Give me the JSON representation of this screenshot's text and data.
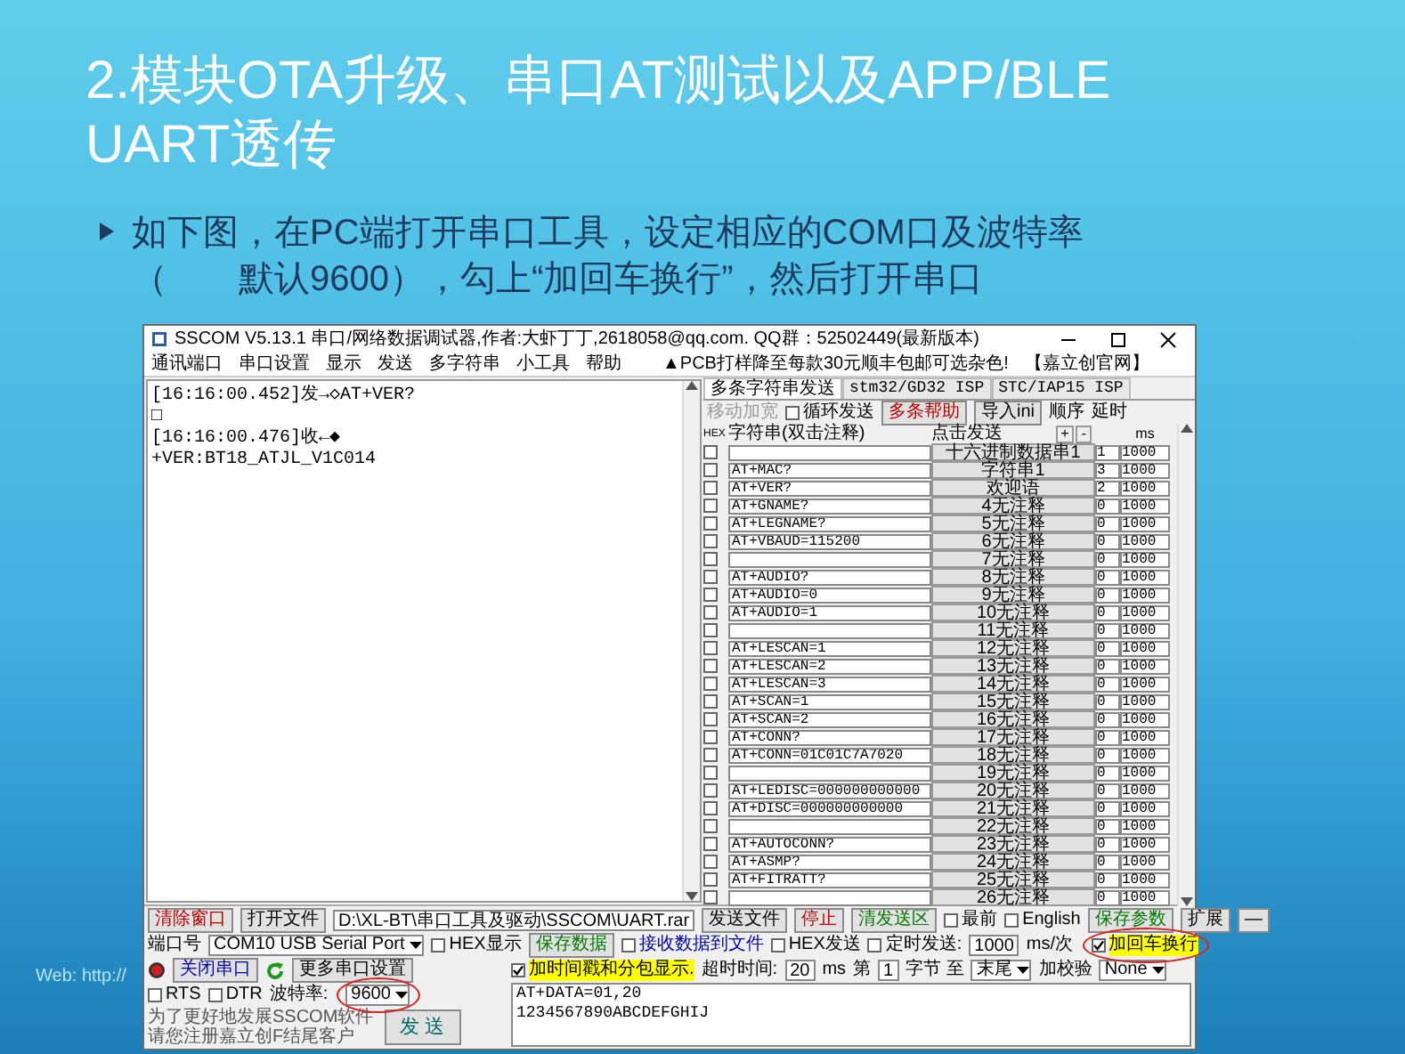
{
  "slide": {
    "title": "2.模块OTA升级、串口AT测试以及APP/BLE UART透传",
    "bullet": "如下图，在PC端打开串口工具，设定相应的COM口及波特率（　　默认9600），勾上“加回车换行”，然后打开串口",
    "footer": "Web: http://"
  },
  "window": {
    "title": "SSCOM V5.13.1 串口/网络数据调试器,作者:大虾丁丁,2618058@qq.com. QQ群：52502449(最新版本)"
  },
  "menu": [
    "通讯端口",
    "串口设置",
    "显示",
    "发送",
    "多字符串",
    "小工具",
    "帮助"
  ],
  "menu_ad": "▲PCB打样降至每款30元顺丰包邮可选杂色!",
  "menu_link": "【嘉立创官网】",
  "receive_lines": [
    "[16:16:00.452]发→◇AT+VER?",
    "□",
    "[16:16:00.476]收←◆",
    "+VER:BT18_ATJL_V1C014"
  ],
  "tabs": [
    {
      "label": "多条字符串发送",
      "selected": true
    },
    {
      "label": "stm32/GD32 ISP",
      "selected": false
    },
    {
      "label": "STC/IAP15 ISP",
      "selected": false
    }
  ],
  "multi_toolbar": [
    {
      "kind": "label",
      "text": "移动加宽",
      "disabled": true
    },
    {
      "kind": "checkbox",
      "label": "循环发送",
      "checked": false
    },
    {
      "kind": "button",
      "label": "多条帮助",
      "color": "#c00000"
    },
    {
      "kind": "button",
      "label": "导入ini"
    },
    {
      "kind": "label",
      "text": "顺序"
    },
    {
      "kind": "label",
      "text": "延时"
    }
  ],
  "columns": {
    "hex": "HEX",
    "string": "字符串(双击注释)",
    "send": "点击发送",
    "plus": "+",
    "minus": "-",
    "delay": "ms"
  },
  "rows": [
    {
      "checked": false,
      "button": "十六进制数据串1",
      "order": "1",
      "delay": "1000"
    },
    {
      "checked": false,
      "text": "AT+MAC?",
      "button": "字符串1",
      "order": "3",
      "delay": "1000"
    },
    {
      "checked": false,
      "text": "AT+VER?",
      "button": "欢迎语",
      "order": "2",
      "delay": "1000"
    },
    {
      "checked": false,
      "text": "AT+GNAME?",
      "button": "4无注释",
      "order": "0",
      "delay": "1000"
    },
    {
      "checked": false,
      "text": "AT+LEGNAME?",
      "button": "5无注释",
      "order": "0",
      "delay": "1000"
    },
    {
      "checked": false,
      "text": "AT+VBAUD=115200",
      "button": "6无注释",
      "order": "0",
      "delay": "1000"
    },
    {
      "checked": false,
      "button": "7无注释",
      "order": "0",
      "delay": "1000"
    },
    {
      "checked": false,
      "text": "AT+AUDIO?",
      "button": "8无注释",
      "order": "0",
      "delay": "1000"
    },
    {
      "checked": false,
      "text": "AT+AUDIO=0",
      "button": "9无注释",
      "order": "0",
      "delay": "1000"
    },
    {
      "checked": false,
      "text": "AT+AUDIO=1",
      "button": "10无注释",
      "order": "0",
      "delay": "1000"
    },
    {
      "checked": false,
      "button": "11无注释",
      "order": "0",
      "delay": "1000"
    },
    {
      "checked": false,
      "text": "AT+LESCAN=1",
      "button": "12无注释",
      "order": "0",
      "delay": "1000"
    },
    {
      "checked": false,
      "text": "AT+LESCAN=2",
      "button": "13无注释",
      "order": "0",
      "delay": "1000"
    },
    {
      "checked": false,
      "text": "AT+LESCAN=3",
      "button": "14无注释",
      "order": "0",
      "delay": "1000"
    },
    {
      "checked": false,
      "text": "AT+SCAN=1",
      "button": "15无注释",
      "order": "0",
      "delay": "1000"
    },
    {
      "checked": false,
      "text": "AT+SCAN=2",
      "button": "16无注释",
      "order": "0",
      "delay": "1000"
    },
    {
      "checked": false,
      "text": "AT+CONN?",
      "button": "17无注释",
      "order": "0",
      "delay": "1000"
    },
    {
      "checked": false,
      "text": "AT+CONN=01C01C7A7020",
      "button": "18无注释",
      "order": "0",
      "delay": "1000"
    },
    {
      "checked": false,
      "button": "19无注释",
      "order": "0",
      "delay": "1000"
    },
    {
      "checked": false,
      "text": "AT+LEDISC=000000000000",
      "button": "20无注释",
      "order": "0",
      "delay": "1000"
    },
    {
      "checked": false,
      "text": "AT+DISC=000000000000",
      "button": "21无注释",
      "order": "0",
      "delay": "1000"
    },
    {
      "checked": false,
      "button": "22无注释",
      "order": "0",
      "delay": "1000"
    },
    {
      "checked": false,
      "text": "AT+AUTOCONN?",
      "button": "23无注释",
      "order": "0",
      "delay": "1000"
    },
    {
      "checked": false,
      "text": "AT+ASMP?",
      "button": "24无注释",
      "order": "0",
      "delay": "1000"
    },
    {
      "checked": false,
      "text": "AT+FITRATT?",
      "button": "25无注释",
      "order": "0",
      "delay": "1000"
    },
    {
      "checked": false,
      "button": "26无注释",
      "order": "0",
      "delay": "1000"
    }
  ],
  "toolbar_row": [
    {
      "kind": "button",
      "label": "清除窗口",
      "color": "#c00000"
    },
    {
      "kind": "button",
      "label": "打开文件"
    },
    {
      "kind": "field",
      "value": "D:\\XL-BT\\串口工具及驱动\\SSCOM\\UART.rar"
    },
    {
      "kind": "button",
      "label": "发送文件"
    },
    {
      "kind": "button",
      "label": "停止",
      "color": "#c00000"
    },
    {
      "kind": "button",
      "label": "清发送区",
      "color": "#007a00"
    },
    {
      "kind": "checkbox",
      "label": "最前",
      "checked": false
    },
    {
      "kind": "checkbox",
      "label": "English",
      "checked": false
    },
    {
      "kind": "button",
      "label": "保存参数",
      "color": "#007a00"
    },
    {
      "kind": "button",
      "label": "扩展"
    },
    {
      "kind": "button",
      "label": "—"
    }
  ],
  "port_row": [
    {
      "kind": "label",
      "text": "端口号"
    },
    {
      "kind": "select",
      "value": "COM10 USB Serial Port"
    },
    {
      "kind": "checkbox",
      "label": "HEX显示",
      "checked": false
    },
    {
      "kind": "button",
      "label": "保存数据",
      "color": "#007a00"
    },
    {
      "kind": "checkbox",
      "label": "接收数据到文件",
      "checked": false,
      "color": "#0000b0"
    },
    {
      "kind": "checkbox",
      "label": "HEX发送",
      "checked": false
    },
    {
      "kind": "checkbox",
      "label": "定时发送:",
      "checked": false
    },
    {
      "kind": "field",
      "value": "1000"
    },
    {
      "kind": "label",
      "text": "ms/次"
    },
    {
      "kind": "checkbox",
      "label": "加回车换行",
      "checked": true,
      "highlight": true,
      "circled": true
    }
  ],
  "left_rows": [
    [
      {
        "kind": "led"
      },
      {
        "kind": "button",
        "label": "关闭串口",
        "color": "#0000b0"
      },
      {
        "kind": "refresh"
      },
      {
        "kind": "button",
        "label": "更多串口设置"
      }
    ],
    [
      {
        "kind": "checkbox",
        "label": "RTS",
        "checked": false
      },
      {
        "kind": "checkbox",
        "label": "DTR",
        "checked": false
      },
      {
        "kind": "label",
        "text": "波特率:"
      },
      {
        "kind": "select",
        "value": "9600",
        "circled": true
      }
    ]
  ],
  "note": [
    "为了更好地发展SSCOM软件",
    "请您注册嘉立创F结尾客户"
  ],
  "send_button": "发 送",
  "timing_row": [
    {
      "kind": "checkbox",
      "label": "加时间戳和分包显示.",
      "checked": true,
      "highlight": true
    },
    {
      "kind": "label",
      "text": "超时时间:"
    },
    {
      "kind": "field",
      "value": "20"
    },
    {
      "kind": "label",
      "text": "ms"
    },
    {
      "kind": "label",
      "text": "第"
    },
    {
      "kind": "field",
      "value": "1"
    },
    {
      "kind": "label",
      "text": "字节 至"
    },
    {
      "kind": "select",
      "value": "末尾"
    },
    {
      "kind": "label",
      "text": "加校验"
    },
    {
      "kind": "select",
      "value": "None"
    }
  ],
  "send_lines": [
    "AT+DATA=01,20",
    "1234567890ABCDEFGHIJ"
  ]
}
